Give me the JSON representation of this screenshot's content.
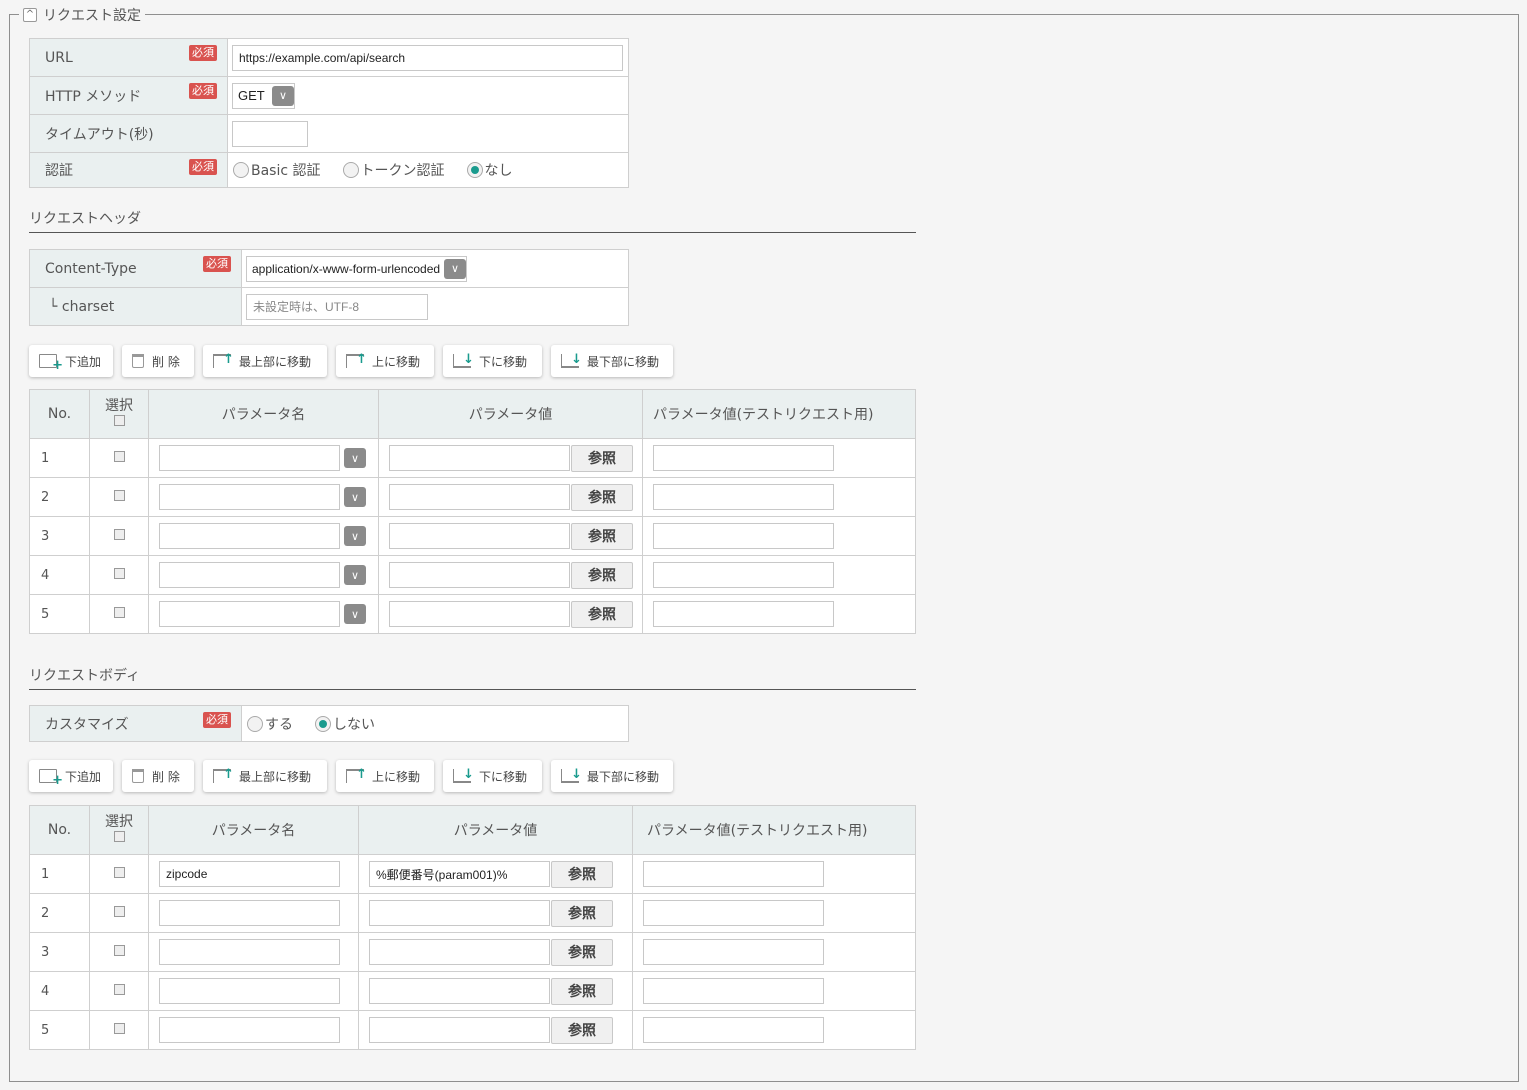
{
  "section": {
    "title": "リクエスト設定",
    "toggle_icon": "chevron-up-icon"
  },
  "required_badge": "必須",
  "basic": {
    "url_label": "URL",
    "url_value": "https://example.com/api/search",
    "method_label": "HTTP メソッド",
    "method_value": "GET",
    "timeout_label": "タイムアウト(秒)",
    "timeout_value": "",
    "auth_label": "認証",
    "auth_options": [
      "Basic 認証",
      "トークン認証",
      "なし"
    ],
    "auth_selected": "なし"
  },
  "header": {
    "title": "リクエストヘッダ",
    "content_type_label": "Content-Type",
    "content_type_value": "application/x-www-form-urlencoded",
    "charset_label": "└ charset",
    "charset_placeholder": "未設定時は、UTF-8"
  },
  "toolbar": {
    "add": "下追加",
    "delete": "削 除",
    "move_top": "最上部に移動",
    "move_up": "上に移動",
    "move_down": "下に移動",
    "move_bottom": "最下部に移動"
  },
  "grid_headers": {
    "no": "No.",
    "select": "選択",
    "param_name": "パラメータ名",
    "param_value": "パラメータ値",
    "param_test_value": "パラメータ値(テストリクエスト用)"
  },
  "ref_button": "参照",
  "header_params": [
    {
      "no": "1",
      "name": "",
      "value": "",
      "test_value": ""
    },
    {
      "no": "2",
      "name": "",
      "value": "",
      "test_value": ""
    },
    {
      "no": "3",
      "name": "",
      "value": "",
      "test_value": ""
    },
    {
      "no": "4",
      "name": "",
      "value": "",
      "test_value": ""
    },
    {
      "no": "5",
      "name": "",
      "value": "",
      "test_value": ""
    }
  ],
  "body": {
    "title": "リクエストボディ",
    "customize_label": "カスタマイズ",
    "customize_options": [
      "する",
      "しない"
    ],
    "customize_selected": "しない"
  },
  "body_params": [
    {
      "no": "1",
      "name": "zipcode",
      "value": "%郵便番号(param001)%",
      "test_value": ""
    },
    {
      "no": "2",
      "name": "",
      "value": "",
      "test_value": ""
    },
    {
      "no": "3",
      "name": "",
      "value": "",
      "test_value": ""
    },
    {
      "no": "4",
      "name": "",
      "value": "",
      "test_value": ""
    },
    {
      "no": "5",
      "name": "",
      "value": "",
      "test_value": ""
    }
  ],
  "colors": {
    "accent": "#1a9b8e",
    "required": "#d9534f",
    "label_bg": "#eaf0f0"
  }
}
